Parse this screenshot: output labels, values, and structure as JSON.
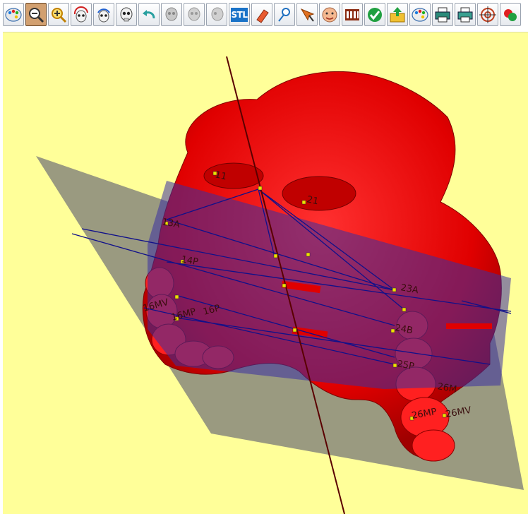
{
  "toolbar": {
    "buttons": [
      {
        "icon": "palette-icon",
        "label": ""
      },
      {
        "icon": "zoom-out-icon",
        "label": "",
        "active": true
      },
      {
        "icon": "zoom-in-icon",
        "label": ""
      },
      {
        "icon": "rotate-skull-left-icon",
        "label": ""
      },
      {
        "icon": "rotate-skull-up-icon",
        "label": ""
      },
      {
        "icon": "skull-front-icon",
        "label": ""
      },
      {
        "icon": "undo-arrow-icon",
        "label": ""
      },
      {
        "icon": "skull-grey-icon",
        "label": ""
      },
      {
        "icon": "skull-side-grey-icon",
        "label": ""
      },
      {
        "icon": "skull-lateral-grey-icon",
        "label": ""
      },
      {
        "icon": "stl-export-icon",
        "label": "STL"
      },
      {
        "icon": "eraser-icon",
        "label": ""
      },
      {
        "icon": "measure-pin-icon",
        "label": ""
      },
      {
        "icon": "pick-point-icon",
        "label": ""
      },
      {
        "icon": "face-icon",
        "label": ""
      },
      {
        "icon": "teeth-chart-icon",
        "label": ""
      },
      {
        "icon": "check-icon",
        "label": ""
      },
      {
        "icon": "export-folder-icon",
        "label": ""
      },
      {
        "icon": "color-palette-icon",
        "label": ""
      },
      {
        "icon": "print-icon",
        "label": ""
      },
      {
        "icon": "print-preview-icon",
        "label": ""
      },
      {
        "icon": "target-icon",
        "label": ""
      },
      {
        "icon": "color-spheres-icon",
        "label": ""
      }
    ]
  },
  "viewport": {
    "background_color": "#ffff99",
    "plane_color": "#9a9a80",
    "model_color": "#e60000",
    "landmark_labels": [
      "11",
      "21",
      "13A",
      "14P",
      "23A",
      "24B",
      "25P",
      "26M",
      "26MP",
      "26MV",
      "16MV",
      "16MP",
      "16P"
    ]
  }
}
